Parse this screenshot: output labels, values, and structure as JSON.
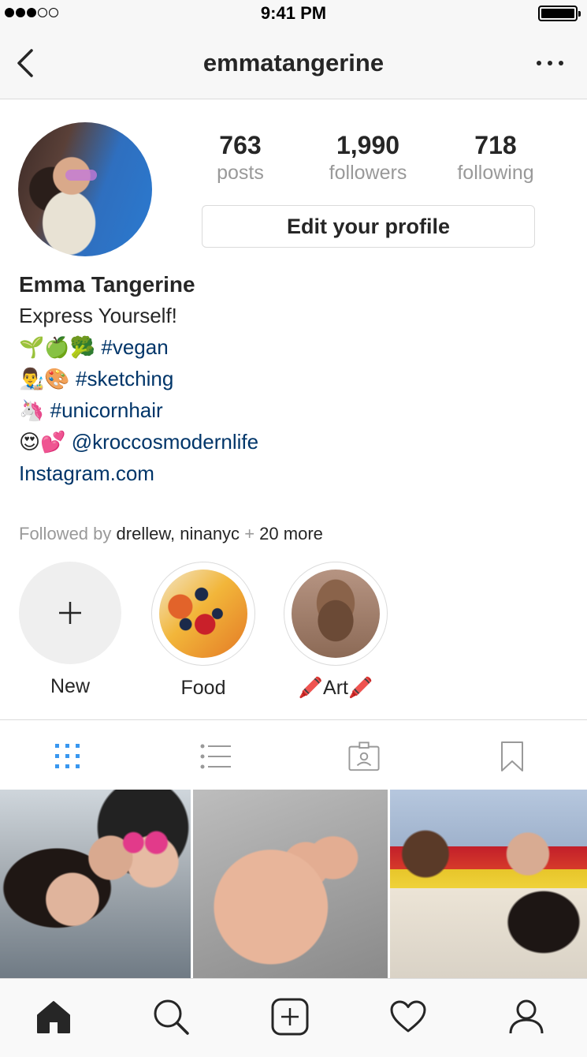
{
  "status_bar": {
    "time": "9:41 PM",
    "signal_bars": 3,
    "signal_total": 5
  },
  "nav": {
    "username": "emmatangerine",
    "back_icon": "chevron-left-icon",
    "more_icon": "more-dots-icon"
  },
  "stats": {
    "posts": {
      "count": "763",
      "label": "posts"
    },
    "followers": {
      "count": "1,990",
      "label": "followers"
    },
    "following": {
      "count": "718",
      "label": "following"
    }
  },
  "edit_button": "Edit your profile",
  "bio": {
    "name": "Emma Tangerine",
    "tagline": "Express Yourself!",
    "lines": [
      {
        "emoji": "🌱🍏🥦",
        "text": "#vegan"
      },
      {
        "emoji": "👨‍🎨🎨",
        "text": "#sketching"
      },
      {
        "emoji": "🦄",
        "text": "#unicornhair"
      },
      {
        "emoji": "😍💕",
        "text": "@kroccosmodernlife"
      }
    ],
    "website": "Instagram.com"
  },
  "followed_by": {
    "prefix": "Followed by",
    "names": "drellew, ninanyc",
    "plus": "+",
    "more": "20 more"
  },
  "highlights": [
    {
      "label": "New",
      "icon": "plus-icon"
    },
    {
      "label": "Food"
    },
    {
      "label": "Art",
      "emoji": "🖍️"
    }
  ],
  "view_tabs": [
    "grid-icon",
    "list-icon",
    "tagged-icon",
    "bookmark-icon"
  ],
  "active_view_tab": "grid-icon",
  "colors": {
    "link": "#003569",
    "active_tab": "#3897f0",
    "muted": "#999999",
    "border": "#dbdbdb"
  },
  "bottom_tabs": [
    "home-icon",
    "search-icon",
    "new-post-icon",
    "heart-icon",
    "profile-icon"
  ]
}
